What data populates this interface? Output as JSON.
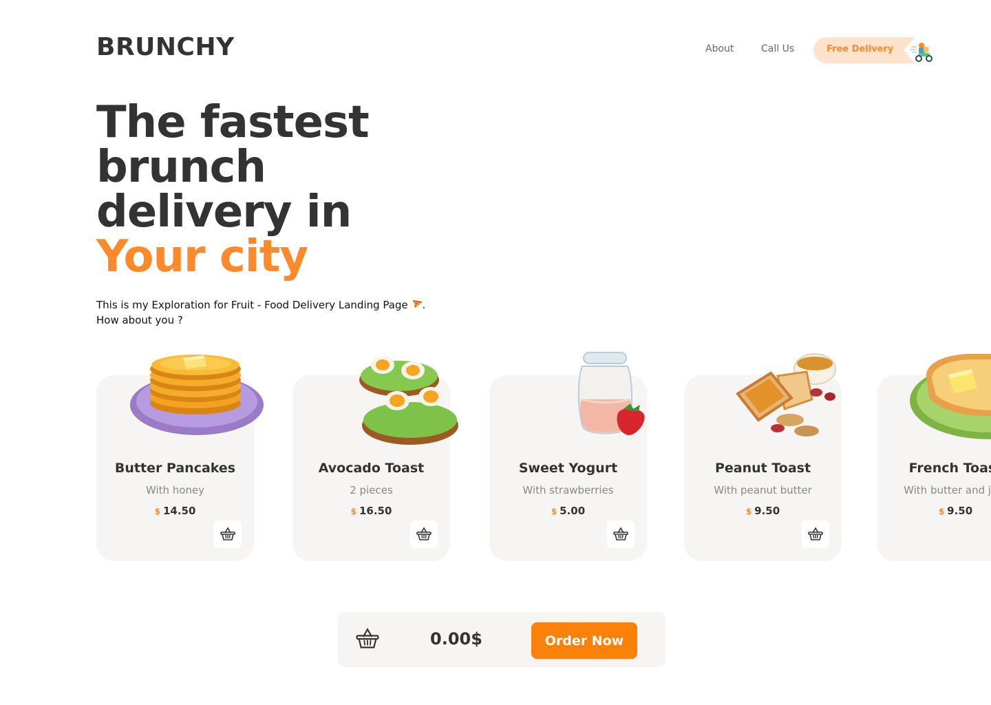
{
  "brand": {
    "logo": "BRUNCHY"
  },
  "nav": {
    "about": "About",
    "call_us": "Call Us",
    "free_delivery": "Free Delivery",
    "delivery_icon": "scooter-icon"
  },
  "hero": {
    "line1": "The fastest",
    "line2": "brunch",
    "line3": "delivery in",
    "accent": "Your city",
    "subtitle_line1": "This is my Exploration for Fruit - Food Delivery Landing Page",
    "subtitle_after_icon": ".",
    "subtitle_line2": "How about you ?"
  },
  "products": [
    {
      "name": "Butter Pancakes",
      "desc": "With honey",
      "currency": "$",
      "price": "14.50",
      "icon": "pancakes-icon"
    },
    {
      "name": "Avocado Toast",
      "desc": "2 pieces",
      "currency": "$",
      "price": "16.50",
      "icon": "avocado-toast-icon"
    },
    {
      "name": "Sweet Yogurt",
      "desc": "With strawberries",
      "currency": "$",
      "price": "5.00",
      "icon": "yogurt-icon"
    },
    {
      "name": "Peanut Toast",
      "desc": "With peanut butter",
      "currency": "$",
      "price": "9.50",
      "icon": "peanut-toast-icon"
    },
    {
      "name": "French Toast",
      "desc": "With butter and jam",
      "currency": "$",
      "price": "9.50",
      "icon": "french-toast-icon"
    }
  ],
  "cart": {
    "total": "0.00$",
    "order_label": "Order Now"
  },
  "colors": {
    "accent": "#fb8a2a",
    "button": "#fb8109",
    "card_bg": "#f6f5f3",
    "text_dark": "#333333"
  }
}
